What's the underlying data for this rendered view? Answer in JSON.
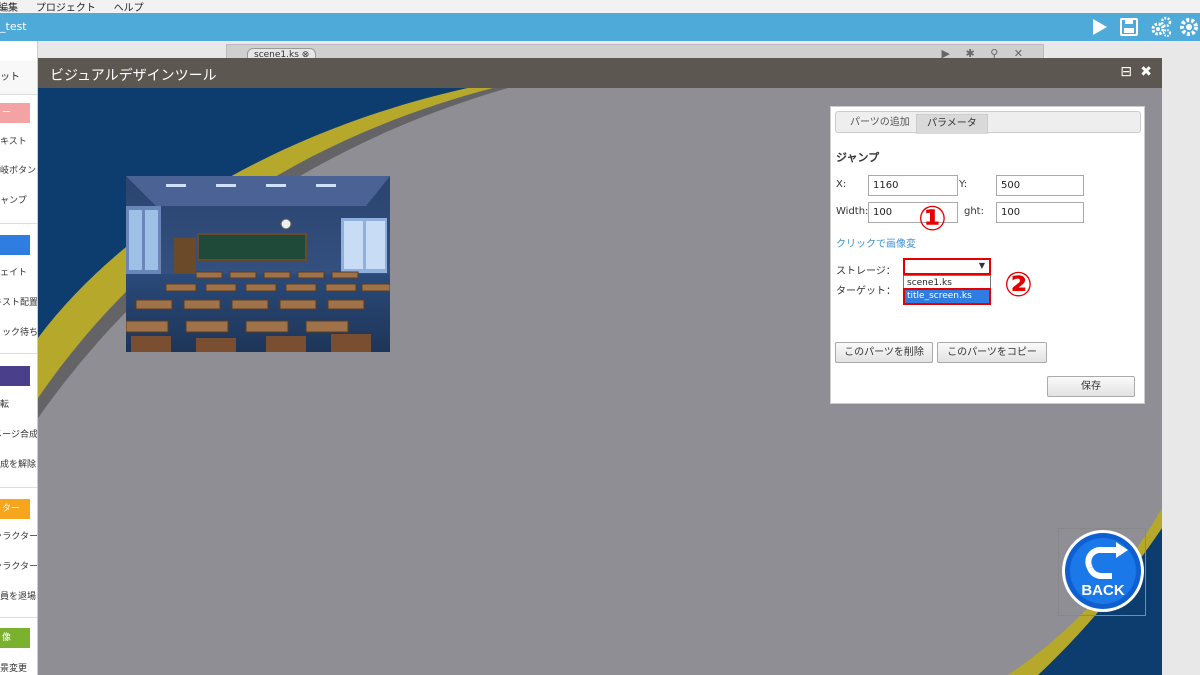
{
  "menu": [
    "編集",
    "プロジェクト",
    "ヘルプ"
  ],
  "project_name": "_test",
  "toolbar_icons": [
    "play-icon",
    "save-icon",
    "gears-icon",
    "gear-icon"
  ],
  "editor": {
    "scene_tab": "scene1.ks ⊗",
    "strip_icons": "▶ ✱ ⚲ ✕"
  },
  "sidebar": {
    "tab": "ット",
    "sections": [
      {
        "header": "ー",
        "color": "#f4a3a5",
        "items": [
          "キスト",
          "岐ボタン",
          "ャンプ"
        ]
      },
      {
        "header": "",
        "color": "#2f7de1",
        "items": [
          "ェイト",
          "キスト配置",
          "リック待ち"
        ]
      },
      {
        "header": "",
        "color": "#4a3f8a",
        "items": [
          "転",
          "メージ合成",
          "成を解除"
        ]
      },
      {
        "header": "ター",
        "color": "#f6a51d",
        "items": [
          "ャラクター",
          "ャラクター",
          "員を退場"
        ]
      },
      {
        "header": "像",
        "color": "#7ab22f",
        "items": [
          "景変更"
        ]
      }
    ]
  },
  "window": {
    "title": "ビジュアルデザインツール",
    "min_icon": "⊟",
    "close_icon": "✖"
  },
  "panel": {
    "tab_add": "パーツの追加",
    "tab_param": "パラメータ",
    "heading": "ジャンプ",
    "x_label": "X:",
    "x_value": "1160",
    "y_label": "Y:",
    "y_value": "500",
    "width_label": "Width:",
    "width_value": "100",
    "height_label": "ght:",
    "height_value": "100",
    "image_link": "クリックで画像変",
    "storage_label": "ストレージ：",
    "storage_value": "",
    "storage_options": [
      "scene1.ks",
      "title_screen.ks"
    ],
    "selected_option": "title_screen.ks",
    "target_label": "ターゲット：",
    "delete_button": "このパーツを削除",
    "copy_button": "このパーツをコピー",
    "save_button": "保存"
  },
  "callouts": [
    "①",
    "②"
  ],
  "back_button": "BACK",
  "colors": {
    "accent_blue": "#4eaad8",
    "highlight_red": "#e60000",
    "stage_gray": "#8f8e94",
    "stage_navy": "#0d3d6e",
    "stage_olive": "#b5a82a"
  }
}
